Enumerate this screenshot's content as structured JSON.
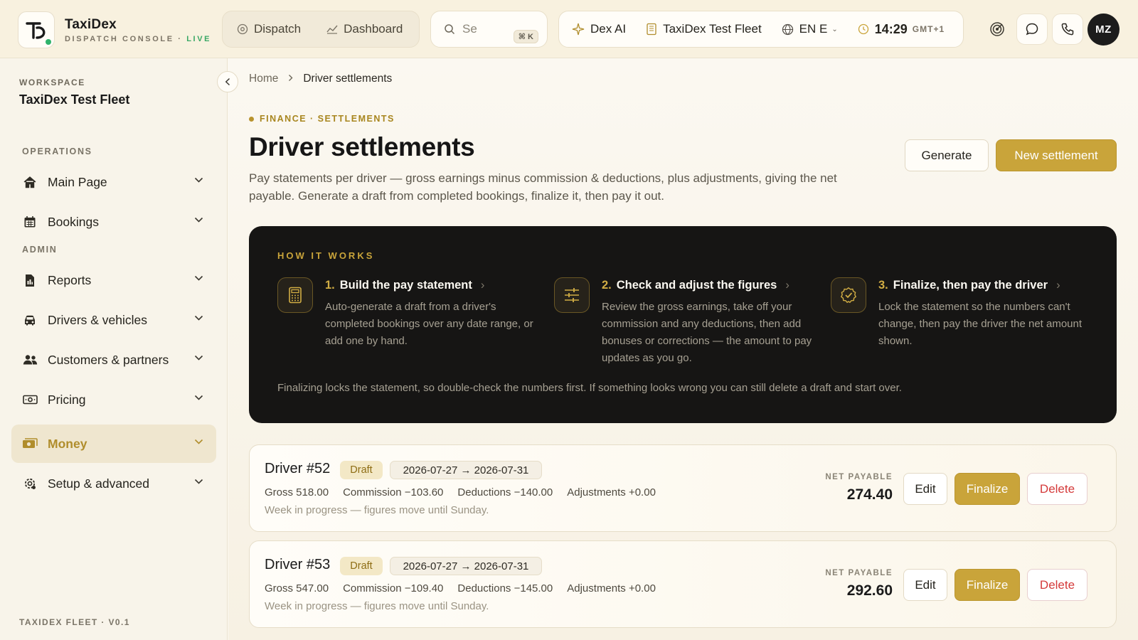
{
  "brand": {
    "name": "TaxiDex",
    "subtitle": "DISPATCH CONSOLE · ",
    "live": "LIVE"
  },
  "topnav": {
    "dispatch": "Dispatch",
    "dashboard": "Dashboard"
  },
  "search": {
    "placeholder": "Se",
    "shortcut": "⌘ K"
  },
  "context": {
    "ai": "Dex AI",
    "fleet": "TaxiDex Test Fleet",
    "lang": "EN E",
    "time": "14:29",
    "tz": "GMT+1"
  },
  "user": {
    "initials": "MZ"
  },
  "sidebar": {
    "workspace_label": "WORKSPACE",
    "workspace_name": "TaxiDex Test Fleet",
    "section_operations": "OPERATIONS",
    "section_admin": "ADMIN",
    "items": [
      {
        "label": "Main Page",
        "icon": "home-icon"
      },
      {
        "label": "Bookings",
        "icon": "calendar-icon"
      },
      {
        "label": "Reports",
        "icon": "report-icon"
      },
      {
        "label": "Drivers & vehicles",
        "icon": "car-icon"
      },
      {
        "label": "Customers & partners",
        "icon": "users-icon"
      },
      {
        "label": "Pricing",
        "icon": "cash-icon"
      },
      {
        "label": "Money",
        "icon": "money-icon",
        "active": true
      },
      {
        "label": "Setup & advanced",
        "icon": "settings-icon"
      }
    ],
    "footer": "TAXIDEX FLEET · V0.1"
  },
  "breadcrumb": {
    "home": "Home",
    "current": "Driver settlements"
  },
  "page": {
    "eyebrow": "FINANCE · SETTLEMENTS",
    "title": "Driver settlements",
    "description": "Pay statements per driver — gross earnings minus commission & deductions, plus adjustments, giving the net payable. Generate a draft from completed bookings, finalize it, then pay it out.",
    "generate_label": "Generate",
    "new_label": "New settlement"
  },
  "how": {
    "label": "HOW IT WORKS",
    "steps": [
      {
        "num": "1.",
        "title": "Build the pay statement",
        "desc": "Auto-generate a draft from a driver's completed bookings over any date range, or add one by hand."
      },
      {
        "num": "2.",
        "title": "Check and adjust the figures",
        "desc": "Review the gross earnings, take off your commission and any deductions, then add bonuses or corrections — the amount to pay updates as you go."
      },
      {
        "num": "3.",
        "title": "Finalize, then pay the driver",
        "desc": "Lock the statement so the numbers can't change, then pay the driver the net amount shown."
      }
    ],
    "note": "Finalizing locks the statement, so double-check the numbers first. If something looks wrong you can still delete a draft and start over."
  },
  "settlements": [
    {
      "driver": "Driver #52",
      "status": "Draft",
      "range": "2026-07-27 → 2026-07-31",
      "gross": "Gross 518.00",
      "commission": "Commission −103.60",
      "deductions": "Deductions −140.00",
      "adjustments": "Adjustments +0.00",
      "note": "Week in progress — figures move until Sunday.",
      "net_label": "NET PAYABLE",
      "net": "274.40"
    },
    {
      "driver": "Driver #53",
      "status": "Draft",
      "range": "2026-07-27 → 2026-07-31",
      "gross": "Gross 547.00",
      "commission": "Commission −109.40",
      "deductions": "Deductions −145.00",
      "adjustments": "Adjustments +0.00",
      "note": "Week in progress — figures move until Sunday.",
      "net_label": "NET PAYABLE",
      "net": "292.60"
    }
  ],
  "actions": {
    "edit": "Edit",
    "finalize": "Finalize",
    "delete": "Delete"
  },
  "colors": {
    "accent": "#c9a43a",
    "live": "#3aa865",
    "danger": "#d43a3a",
    "panel": "#161514"
  }
}
